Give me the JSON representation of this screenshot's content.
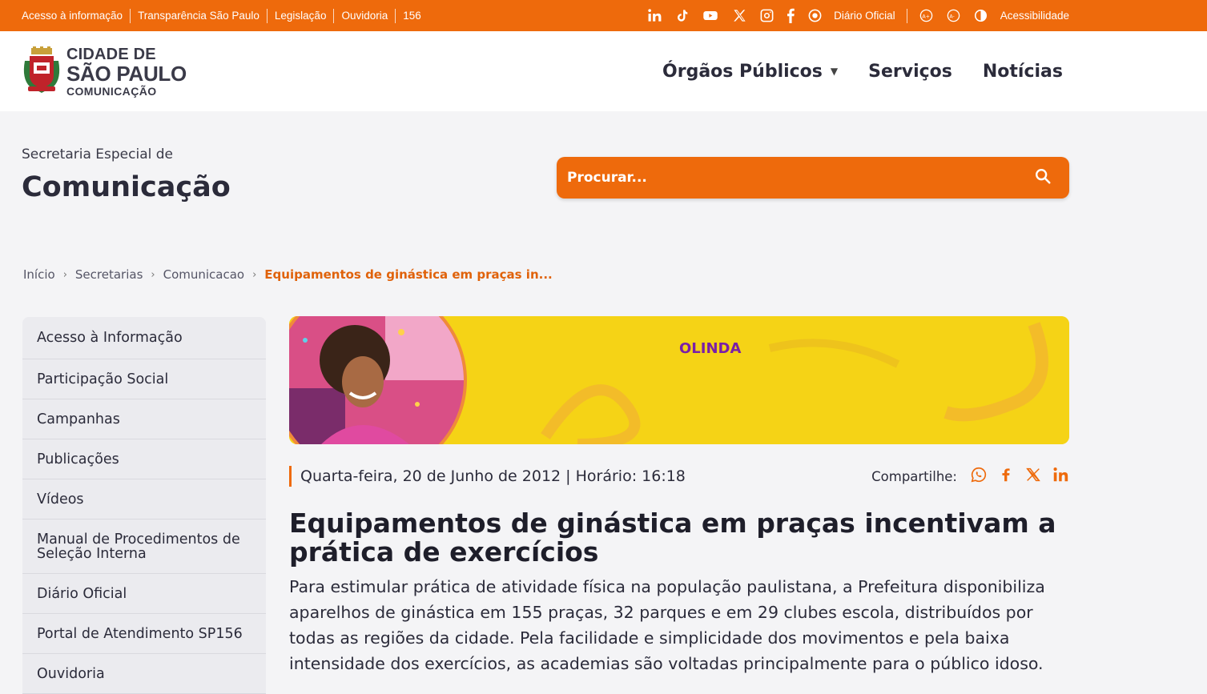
{
  "topbar": {
    "links": [
      "Acesso à informação",
      "Transparência São Paulo",
      "Legislação",
      "Ouvidoria",
      "156"
    ],
    "diario_label": "Diário Oficial",
    "accessibility_label": "Acessibilidade",
    "background": "#ee6a0c"
  },
  "header": {
    "logo_line1": "CIDADE DE",
    "logo_line2": "SÃO PAULO",
    "logo_line3": "COMUNICAÇÃO",
    "nav": [
      "Órgãos Públicos",
      "Serviços",
      "Notícias"
    ]
  },
  "section": {
    "kicker": "Secretaria Especial de",
    "title": "Comunicação"
  },
  "search": {
    "placeholder": "Procurar..."
  },
  "breadcrumb": {
    "items": [
      "Início",
      "Secretarias",
      "Comunicacao"
    ],
    "current": "Equipamentos de ginástica em praças in..."
  },
  "sidebar": {
    "items": [
      "Acesso à Informação",
      "Participação Social",
      "Campanhas",
      "Publicações",
      "Vídeos",
      "Manual de Procedimentos de Seleção Interna",
      "Diário Oficial",
      "Portal de Atendimento SP156",
      "Ouvidoria"
    ]
  },
  "article": {
    "banner_text": "OLINDA",
    "date": "Quarta-feira, 20 de Junho de 2012 | Horário: 16:18",
    "share_label": "Compartilhe:",
    "title": "Equipamentos de ginástica em praças incentivam a prática de exercícios",
    "body": "Para estimular prática de atividade física na população paulistana, a Prefeitura disponibiliza aparelhos de ginástica em 155 praças, 32 parques e em 29 clubes escola, distribuídos por todas as regiões da cidade. Pela facilidade e simplicidade dos movimentos e pela baixa intensidade dos exercícios, as academias são voltadas principalmente para o público idoso."
  },
  "colors": {
    "accent": "#ee6a0c",
    "text": "#2b2b3a",
    "banner_yellow": "#f5d316"
  }
}
